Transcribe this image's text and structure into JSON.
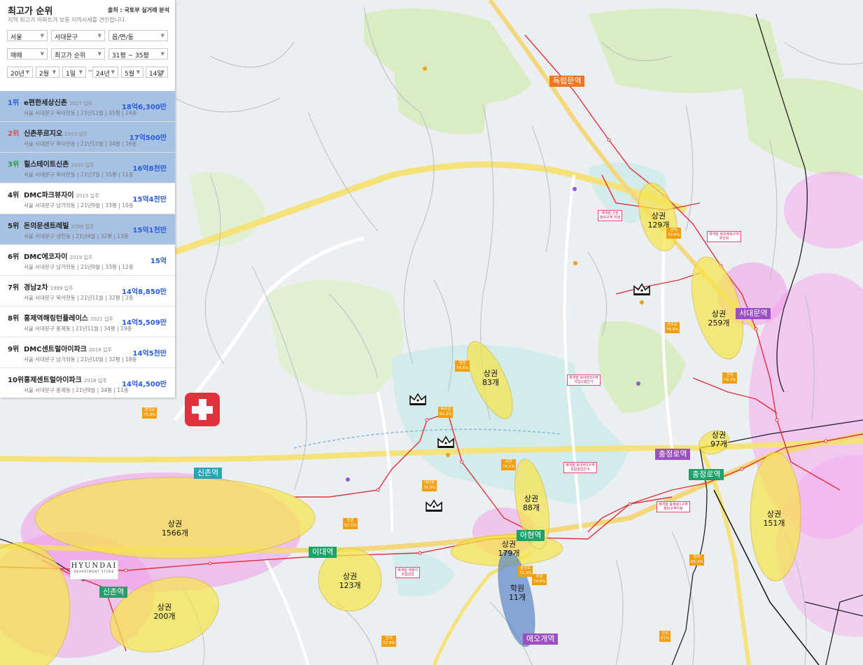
{
  "panel": {
    "title": "최고가 순위",
    "source": "출처 : 국토부 실거래 분석",
    "description": "지역 최고가 아파트가 보통 지역시세를 견인합니다.",
    "filters": {
      "region": "서울",
      "district": "서대문구",
      "dong": "읍/면/동",
      "trade": "매매",
      "sort": "최고가 순위",
      "area": "31평 ~ 35평"
    },
    "date_range": {
      "from_year": "20년",
      "from_month": "2월",
      "from_day": "1일",
      "separator": "~",
      "to_year": "24년",
      "to_month": "5월",
      "to_day": "14일"
    },
    "ranking": [
      {
        "rank": "1위",
        "name": "e편한세상신촌",
        "year": "2017 입주",
        "addr": "서울 서대문구 북아현동 | 21년12월 | 35평 | 24층",
        "price": "18억6,300만",
        "highlight": true,
        "rank_color": "#2a5bd7"
      },
      {
        "rank": "2위",
        "name": "신촌푸르지오",
        "year": "2015 입주",
        "addr": "서울 서대문구 북아현동 | 21년10월 | 34평 | 16층",
        "price": "17억500만",
        "highlight": true,
        "rank_color": "#d9534f"
      },
      {
        "rank": "3위",
        "name": "힐스테이트신촌",
        "year": "2020 입주",
        "addr": "서울 서대문구 북아현동 | 21년7월 | 35평 | 11층",
        "price": "16억8천만",
        "highlight": true,
        "rank_color": "#2e9e48"
      },
      {
        "rank": "4위",
        "name": "DMC파크뷰자이",
        "year": "2015 입주",
        "addr": "서울 서대문구 남가좌동 | 21년9월 | 33평 | 10층",
        "price": "15억4천만",
        "highlight": false,
        "rank_color": "#222222"
      },
      {
        "rank": "5위",
        "name": "돈의문센트레빌",
        "year": "2009 입주",
        "addr": "서울 서대문구 냉천동 | 21년4월 | 32평 | 13층",
        "price": "15억1천만",
        "highlight": true,
        "rank_color": "#222222"
      },
      {
        "rank": "6위",
        "name": "DMC에코자이",
        "year": "2019 입주",
        "addr": "서울 서대문구 남가좌동 | 21년9월 | 33평 | 12층",
        "price": "15억",
        "highlight": false,
        "rank_color": "#222222"
      },
      {
        "rank": "7위",
        "name": "경남2차",
        "year": "1999 입주",
        "addr": "서울 서대문구 북아현동 | 21년11월 | 32평 | 2층",
        "price": "14억8,850만",
        "highlight": false,
        "rank_color": "#222222"
      },
      {
        "rank": "8위",
        "name": "홍제역해링턴플레이스",
        "year": "2021 입주",
        "addr": "서울 서대문구 홍제동 | 21년11월 | 34평 | 19층",
        "price": "14억5,509만",
        "highlight": false,
        "rank_color": "#222222"
      },
      {
        "rank": "9위",
        "name": "DMC센트럴아이파크",
        "year": "2018 입주",
        "addr": "서울 서대문구 남가좌동 | 21년10월 | 32평 | 18층",
        "price": "14억5천만",
        "highlight": false,
        "rank_color": "#222222"
      },
      {
        "rank": "10위",
        "name": "홍제센트럴아이파크",
        "year": "2018 입주",
        "addr": "서울 서대문구 홍제동 | 21년9월 | 34평 | 11층",
        "price": "14억4,500만",
        "highlight": false,
        "rank_color": "#222222"
      }
    ]
  },
  "map": {
    "zones": [
      {
        "id": "z1566",
        "kind": "상권",
        "count": "1566개"
      },
      {
        "id": "z200",
        "kind": "상권",
        "count": "200개"
      },
      {
        "id": "z123",
        "kind": "상권",
        "count": "123개"
      },
      {
        "id": "z179",
        "kind": "상권",
        "count": "179개"
      },
      {
        "id": "zhak",
        "kind": "학원",
        "count": "11개"
      },
      {
        "id": "z88",
        "kind": "상권",
        "count": "88개"
      },
      {
        "id": "z83",
        "kind": "상권",
        "count": "83개"
      },
      {
        "id": "z129",
        "kind": "상권",
        "count": "129개"
      },
      {
        "id": "z259",
        "kind": "상권",
        "count": "259개"
      },
      {
        "id": "z97",
        "kind": "상권",
        "count": "97개"
      },
      {
        "id": "z151",
        "kind": "상권",
        "count": "151개"
      }
    ],
    "stations": [
      {
        "id": "dongnimmun",
        "name": "독립문역",
        "color": "#ef7622"
      },
      {
        "id": "seodaemun",
        "name": "서대문역",
        "color": "#9b4fc2"
      },
      {
        "id": "chungjeongno5",
        "name": "충정로역",
        "color": "#9b4fc2"
      },
      {
        "id": "chungjeongno2",
        "name": "충정로역",
        "color": "#1ca26a"
      },
      {
        "id": "sinchon_g",
        "name": "신촌역",
        "color": "#25a5b5"
      },
      {
        "id": "sinchon2",
        "name": "신촌역",
        "color": "#1ca26a"
      },
      {
        "id": "idae",
        "name": "이대역",
        "color": "#1ca26a"
      },
      {
        "id": "ahyeon",
        "name": "아현역",
        "color": "#1ca26a"
      },
      {
        "id": "aeogae",
        "name": "애오개역",
        "color": "#9b4fc2"
      }
    ],
    "store": {
      "brand": "HYUNDAI",
      "sub": "DEPARTMENT STORE"
    },
    "orange_tags": [
      {
        "id": "t1",
        "l1": "경희궁",
        "l2": "75.9%"
      },
      {
        "id": "t2",
        "l1": "영천",
        "l2": "78.6%"
      },
      {
        "id": "t3",
        "l1": "북아현",
        "l2": "81.2%"
      },
      {
        "id": "t4",
        "l1": "아현",
        "l2": "74.1%"
      },
      {
        "id": "t5",
        "l1": "대신동",
        "l2": "76.9%"
      },
      {
        "id": "t6",
        "l1": "신촌",
        "l2": "82.5%"
      },
      {
        "id": "t7",
        "l1": "충정로",
        "l2": "72.4%"
      },
      {
        "id": "t8",
        "l1": "마포",
        "l2": "74.6%"
      },
      {
        "id": "t9",
        "l1": "공덕",
        "l2": "79.5%"
      },
      {
        "id": "t10",
        "l1": "의주로",
        "l2": "79.9%"
      },
      {
        "id": "t11",
        "l1": "한성",
        "l2": "79.3%"
      },
      {
        "id": "t12",
        "l1": "만리",
        "l2": "71.9%"
      },
      {
        "id": "t13",
        "l1": "청파",
        "l2": "85.4%"
      },
      {
        "id": "t14",
        "l1": "신성",
        "l2": "81%"
      }
    ],
    "pink_tags": [
      {
        "id": "p1",
        "l1": "재개발 예정지",
        "l2": "조합설립"
      },
      {
        "id": "p2",
        "l1": "재개발 북아현3구역",
        "l2": "사업시행인가"
      },
      {
        "id": "p3",
        "l1": "재개발 북아현2구역",
        "l2": "조합설립인가"
      },
      {
        "id": "p4",
        "l1": "재개발 충정로1구역",
        "l2": "정비구역지정"
      },
      {
        "id": "p5",
        "l1": "재개발 정비예정구역",
        "l2": "추진위"
      },
      {
        "id": "p6",
        "l1": "재개발 신촌",
        "l2": "정비구역 지정"
      }
    ]
  }
}
